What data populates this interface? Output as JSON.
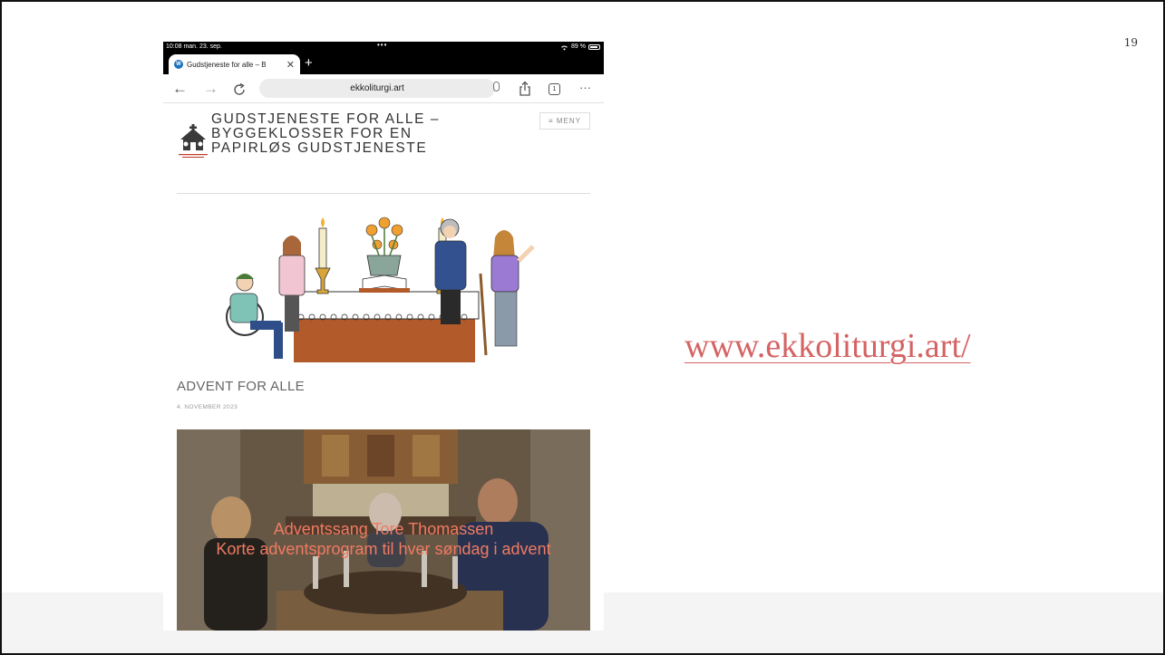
{
  "slide": {
    "number": "19",
    "link_text": "www.ekkoliturgi.art/",
    "link_color": "#d46464"
  },
  "statusbar": {
    "time": "10:08  man. 23. sep.",
    "dots": "•••",
    "battery": "89 %"
  },
  "browser": {
    "tab_title": "Gudstjeneste for alle – B",
    "tab_icon": "wordpress-icon",
    "new_tab_label": "+",
    "url": "ekkoliturgi.art",
    "tab_count": "1",
    "more_label": "···"
  },
  "site": {
    "title": "GUDSTJENESTE FOR ALLE – BYGGEKLOSSER FOR EN PAPIRLØS GUDSTJENESTE",
    "menu_label": "≡ MENY",
    "logo_caption": "GUDSTJENESTE FOR ALLE",
    "post_title": "ADVENT FOR ALLE",
    "post_date": "4. NOVEMBER 2023",
    "video_caption_1": "Adventssang Tore Thomassen",
    "video_caption_2": "Korte adventsprogram til hver søndag i advent",
    "caption_color": "#f07a62"
  }
}
